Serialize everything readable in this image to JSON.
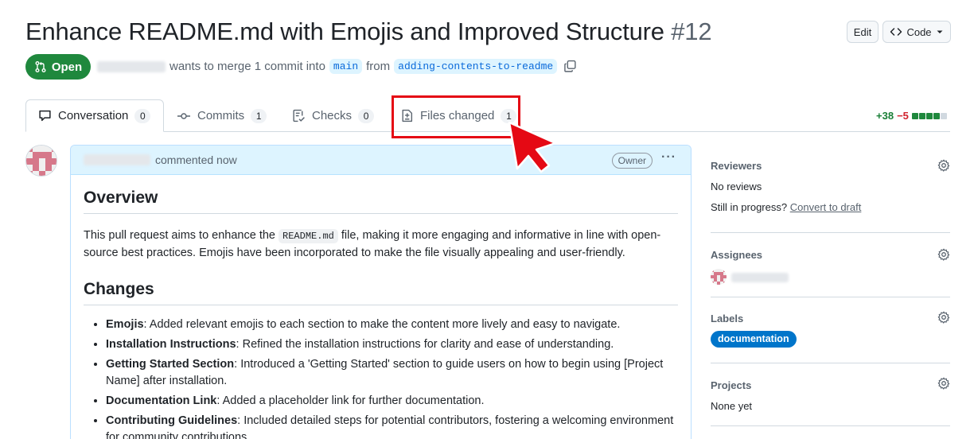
{
  "pr": {
    "title": "Enhance README.md with Emojis and Improved Structure",
    "number": "#12",
    "state": "Open",
    "merge_text": "wants to merge 1 commit into",
    "base_branch": "main",
    "from_text": "from",
    "head_branch": "adding-contents-to-readme"
  },
  "header_buttons": {
    "edit": "Edit",
    "code": "Code"
  },
  "tabs": [
    {
      "label": "Conversation",
      "count": "0"
    },
    {
      "label": "Commits",
      "count": "1"
    },
    {
      "label": "Checks",
      "count": "0"
    },
    {
      "label": "Files changed",
      "count": "1"
    }
  ],
  "diffstat": {
    "additions": "+38",
    "deletions": "−5"
  },
  "comment": {
    "action": "commented now",
    "badge": "Owner",
    "overview_heading": "Overview",
    "overview_pre": "This pull request aims to enhance the ",
    "overview_code": "README.md",
    "overview_post": " file, making it more engaging and informative in line with open-source best practices. Emojis have been incorporated to make the file visually appealing and user-friendly.",
    "changes_heading": "Changes",
    "changes": [
      {
        "term": "Emojis",
        "text": ": Added relevant emojis to each section to make the content more lively and easy to navigate."
      },
      {
        "term": "Installation Instructions",
        "text": ": Refined the installation instructions for clarity and ease of understanding."
      },
      {
        "term": "Getting Started Section",
        "text": ": Introduced a 'Getting Started' section to guide users on how to begin using [Project Name] after installation."
      },
      {
        "term": "Documentation Link",
        "text": ": Added a placeholder link for further documentation."
      },
      {
        "term": "Contributing Guidelines",
        "text": ": Included detailed steps for potential contributors, fostering a welcoming environment for community contributions."
      }
    ]
  },
  "sidebar": {
    "reviewers": {
      "heading": "Reviewers",
      "value": "No reviews",
      "progress_text": "Still in progress?",
      "convert_link": "Convert to draft"
    },
    "assignees": {
      "heading": "Assignees"
    },
    "labels": {
      "heading": "Labels",
      "label": "documentation"
    },
    "projects": {
      "heading": "Projects",
      "value": "None yet"
    }
  },
  "colors": {
    "open_green": "#1f883d",
    "link_blue": "#0969da",
    "label_blue": "#0075ca",
    "highlight_red": "#e50914"
  },
  "icons": [
    "pull-request-icon",
    "copy-icon",
    "comment-icon",
    "commit-icon",
    "checklist-icon",
    "file-diff-icon",
    "kebab-horizontal-icon",
    "gear-icon",
    "code-icon",
    "triangle-down-icon",
    "cursor-arrow-icon"
  ]
}
